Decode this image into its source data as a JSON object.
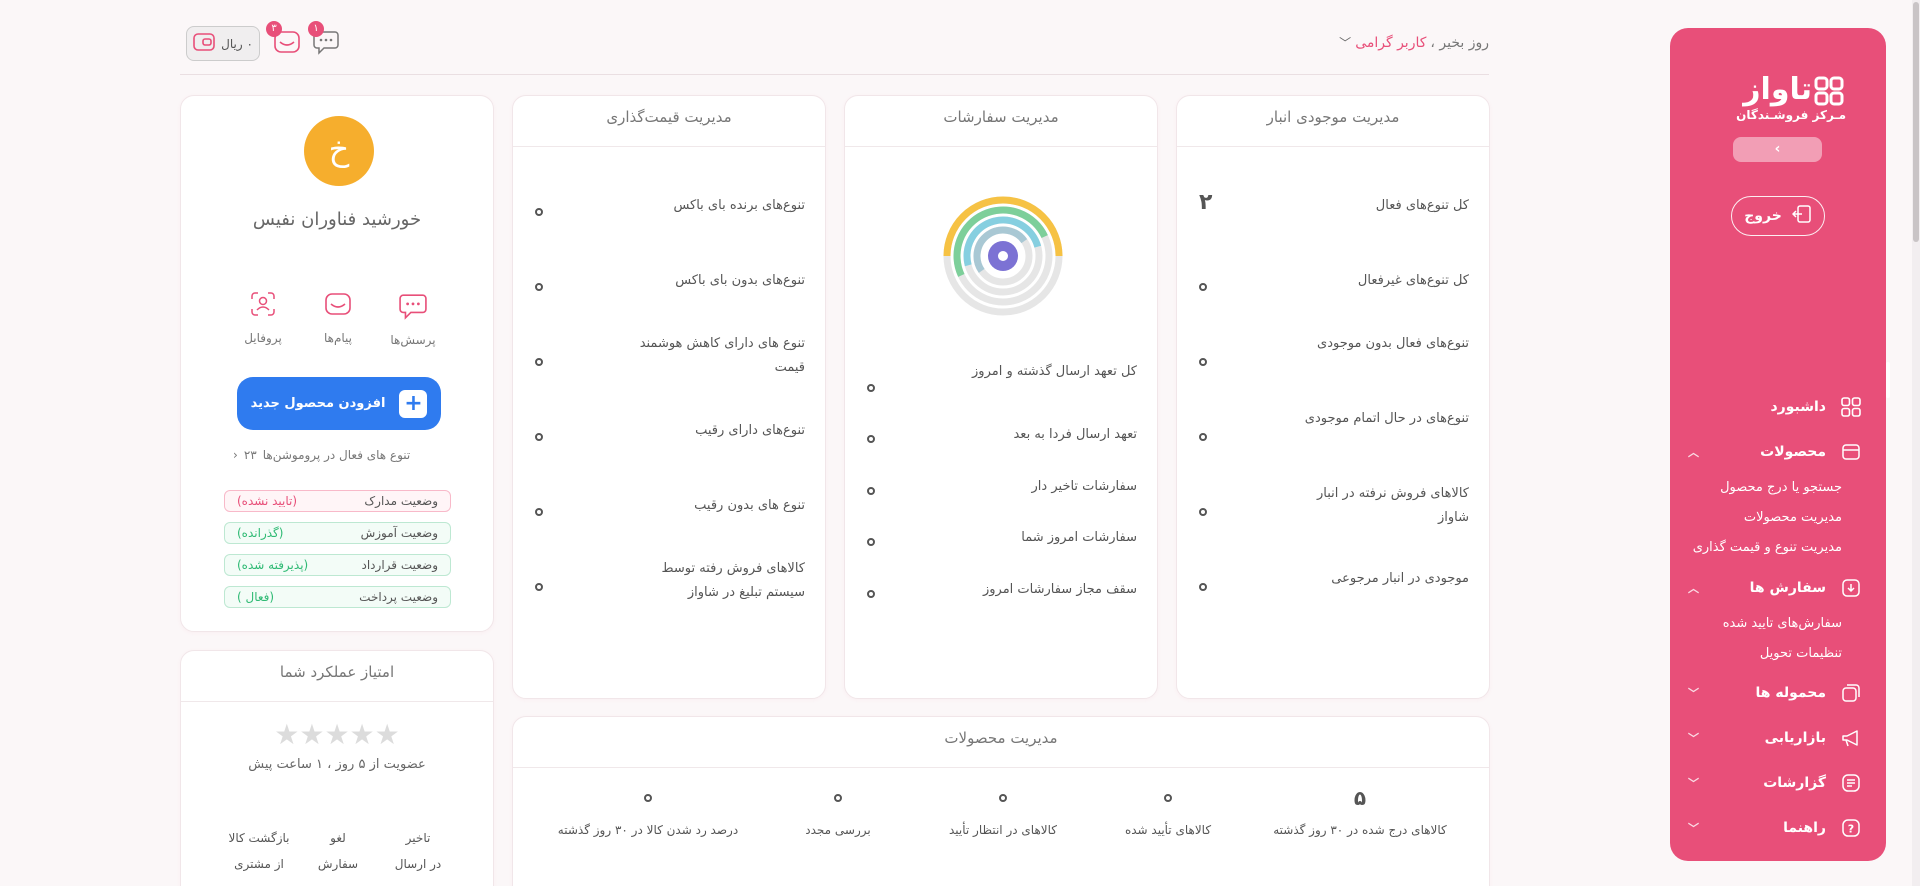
{
  "brand": {
    "name": "تاواز",
    "subtitle": "مـرکز فروشـندگان",
    "collapse_arrow": "‹"
  },
  "sidebar": {
    "logout_label": "خروج",
    "items": [
      {
        "label": "داشبورد",
        "icon": "grid-icon",
        "active": true
      },
      {
        "label": "محصولات",
        "icon": "box-icon",
        "expanded": true
      },
      {
        "label": "سفارش ها",
        "icon": "download-icon",
        "expanded": true
      },
      {
        "label": "محموله ها",
        "icon": "layers-icon"
      },
      {
        "label": "بازاریابی",
        "icon": "megaphone-icon"
      },
      {
        "label": "گزارشات",
        "icon": "report-icon"
      },
      {
        "label": "راهنما",
        "icon": "help-icon"
      }
    ],
    "products_sub": [
      "جستجو یا درج محصول",
      "مدیریت محصولات",
      "مدیریت تنوع و قیمت گذاری"
    ],
    "orders_sub": [
      "سفارش‌های تایید شده",
      "تنظیمات تحویل"
    ]
  },
  "header": {
    "greeting": "روز بخیر ،",
    "user": "کاربر گرامی",
    "wallet": "۰ ریال",
    "messages_badge": "۳",
    "chat_badge": "۱"
  },
  "inventory": {
    "title": "مدیریت موجودی انبار",
    "rows": [
      {
        "label": "کل تنوع‌های فعال",
        "value": "۲"
      },
      {
        "label": "کل تنوع‌های غیرفعال",
        "value": "۰"
      },
      {
        "label": "تنوع‌های فعال بدون موجودی",
        "value": "۰"
      },
      {
        "label": "تنوع‌های در حال اتمام موجودی",
        "value": "۰"
      },
      {
        "label": "کالاهای فروش نرفته در انبار شاواز",
        "value": "۰"
      },
      {
        "label": "موجودی در انبار مرجوعی",
        "value": "۰"
      }
    ]
  },
  "orders": {
    "title": "مدیریت سفارشات",
    "rows": [
      {
        "label": "کل تعهد ارسال گذشته و امروز",
        "value": "۰"
      },
      {
        "label": "تعهد ارسال فردا به بعد",
        "value": "۰"
      },
      {
        "label": "سفارشات تاخیر دار",
        "value": "۰"
      },
      {
        "label": "سفارشات امروز شما",
        "value": "۰"
      },
      {
        "label": "سقف مجاز سفارشات امروز",
        "value": "۰"
      }
    ]
  },
  "pricing": {
    "title": "مدیریت قیمت‌گذاری",
    "rows": [
      {
        "label": "تنوع‌های برنده بای باکس",
        "value": "۰"
      },
      {
        "label": "تنوع‌های بدون بای باکس",
        "value": "۰"
      },
      {
        "label": "تنوع های دارای کاهش هوشمند قیمت",
        "value": "۰"
      },
      {
        "label": "تنوع‌های دارای رقیب",
        "value": "۰"
      },
      {
        "label": "تنوع های بدون رقیب",
        "value": "۰"
      },
      {
        "label": "کالاهای فروش رفته توسط سیستم تبلیغ در شاواز",
        "value": "۰"
      }
    ]
  },
  "profile": {
    "avatar_letter": "خ",
    "company": "خورشید فناوران نفیس",
    "actions": [
      {
        "label": "پرسش‌ها",
        "icon": "chat-icon"
      },
      {
        "label": "پیام‌ها",
        "icon": "mail-icon"
      },
      {
        "label": "پروفایل",
        "icon": "profile-icon"
      }
    ],
    "add_product": "افزودن محصول جدید",
    "promo_label": "تنوع های فعال در پروموشن‌ها",
    "promo_value": "۲۳",
    "statuses": [
      {
        "label": "وضعیت مدارک",
        "value": "(تایید نشده)",
        "tone": "red"
      },
      {
        "label": "وضعیت آموزش",
        "value": "(گذرانده)",
        "tone": "green"
      },
      {
        "label": "وضعیت قرارداد",
        "value": "(پذیرفته شده)",
        "tone": "green"
      },
      {
        "label": "وضعیت پرداخت",
        "value": "(فعال )",
        "tone": "green"
      }
    ]
  },
  "performance": {
    "title": "امتیاز عملکرد شما",
    "stars": "★★★★★",
    "rating": 0,
    "membership": "عضویت از ۵ روز ، ۱ ساعت پیش",
    "metrics": [
      {
        "line1": "تاخیر",
        "line2": "در ارسال"
      },
      {
        "line1": "لغو",
        "line2": "سفارش"
      },
      {
        "line1": "بازگشت کالا",
        "line2": "از مشتری"
      }
    ]
  },
  "product_mgmt": {
    "title": "مدیریت محصولات",
    "cols": [
      {
        "label": "کالاهای درج شده در ۳۰ روز گذشته",
        "value": "۵"
      },
      {
        "label": "کالاهای تأیید شده",
        "value": "۰"
      },
      {
        "label": "کالاهای در انتظار تأیید",
        "value": "۰"
      },
      {
        "label": "بررسی مجدد",
        "value": "۰"
      },
      {
        "label": "درصد رد شدن کالا در ۳۰ روز گذشته",
        "value": "۰"
      }
    ]
  },
  "colors": {
    "brand": "#e84f79",
    "accent_blue": "#2f7bef",
    "avatar": "#f6ae2d",
    "success": "#2fba74"
  }
}
